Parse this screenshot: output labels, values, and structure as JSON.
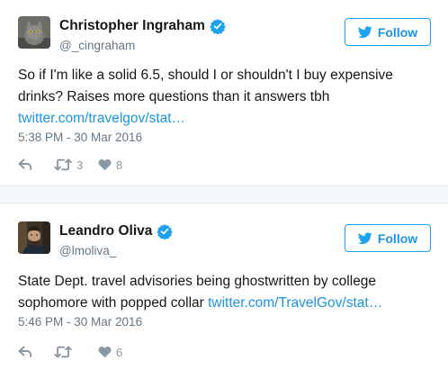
{
  "tweets": [
    {
      "display_name": "Christopher Ingraham",
      "handle": "@_cingraham",
      "follow_label": "Follow",
      "text": "So if I'm like a solid 6.5, should I or shouldn't I buy expensive drinks? Raises more questions than it answers tbh ",
      "link": "twitter.com/travelgov/stat…",
      "timestamp": "5:38 PM - 30 Mar 2016",
      "retweets": "3",
      "likes": "8",
      "avatar": "cat-photo"
    },
    {
      "display_name": "Leandro Oliva",
      "handle": "@lmoliva_",
      "follow_label": "Follow",
      "text": "State Dept. travel advisories being ghostwritten by college sophomore with popped collar ",
      "link": "twitter.com/TravelGov/stat…",
      "timestamp": "5:46 PM - 30 Mar 2016",
      "retweets": "",
      "likes": "6",
      "avatar": "man-photo"
    }
  ],
  "colors": {
    "accent": "#1da1f2",
    "link": "#1b95e0",
    "muted": "#657786",
    "icon": "#8899a6",
    "background": "#f5f8fa"
  },
  "icons": {
    "verified": "verified-badge-icon",
    "follow": "twitter-bird-icon",
    "reply": "reply-icon",
    "retweet": "retweet-icon",
    "like": "heart-icon"
  }
}
